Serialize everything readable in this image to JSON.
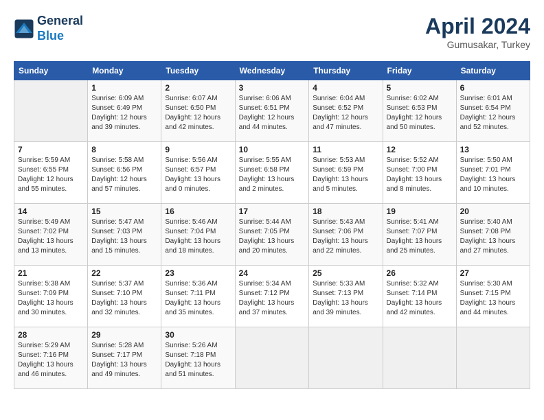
{
  "header": {
    "logo_line1": "General",
    "logo_line2": "Blue",
    "month": "April 2024",
    "location": "Gumusakar, Turkey"
  },
  "columns": [
    "Sunday",
    "Monday",
    "Tuesday",
    "Wednesday",
    "Thursday",
    "Friday",
    "Saturday"
  ],
  "weeks": [
    [
      {
        "day": "",
        "info": ""
      },
      {
        "day": "1",
        "info": "Sunrise: 6:09 AM\nSunset: 6:49 PM\nDaylight: 12 hours\nand 39 minutes."
      },
      {
        "day": "2",
        "info": "Sunrise: 6:07 AM\nSunset: 6:50 PM\nDaylight: 12 hours\nand 42 minutes."
      },
      {
        "day": "3",
        "info": "Sunrise: 6:06 AM\nSunset: 6:51 PM\nDaylight: 12 hours\nand 44 minutes."
      },
      {
        "day": "4",
        "info": "Sunrise: 6:04 AM\nSunset: 6:52 PM\nDaylight: 12 hours\nand 47 minutes."
      },
      {
        "day": "5",
        "info": "Sunrise: 6:02 AM\nSunset: 6:53 PM\nDaylight: 12 hours\nand 50 minutes."
      },
      {
        "day": "6",
        "info": "Sunrise: 6:01 AM\nSunset: 6:54 PM\nDaylight: 12 hours\nand 52 minutes."
      }
    ],
    [
      {
        "day": "7",
        "info": "Sunrise: 5:59 AM\nSunset: 6:55 PM\nDaylight: 12 hours\nand 55 minutes."
      },
      {
        "day": "8",
        "info": "Sunrise: 5:58 AM\nSunset: 6:56 PM\nDaylight: 12 hours\nand 57 minutes."
      },
      {
        "day": "9",
        "info": "Sunrise: 5:56 AM\nSunset: 6:57 PM\nDaylight: 13 hours\nand 0 minutes."
      },
      {
        "day": "10",
        "info": "Sunrise: 5:55 AM\nSunset: 6:58 PM\nDaylight: 13 hours\nand 2 minutes."
      },
      {
        "day": "11",
        "info": "Sunrise: 5:53 AM\nSunset: 6:59 PM\nDaylight: 13 hours\nand 5 minutes."
      },
      {
        "day": "12",
        "info": "Sunrise: 5:52 AM\nSunset: 7:00 PM\nDaylight: 13 hours\nand 8 minutes."
      },
      {
        "day": "13",
        "info": "Sunrise: 5:50 AM\nSunset: 7:01 PM\nDaylight: 13 hours\nand 10 minutes."
      }
    ],
    [
      {
        "day": "14",
        "info": "Sunrise: 5:49 AM\nSunset: 7:02 PM\nDaylight: 13 hours\nand 13 minutes."
      },
      {
        "day": "15",
        "info": "Sunrise: 5:47 AM\nSunset: 7:03 PM\nDaylight: 13 hours\nand 15 minutes."
      },
      {
        "day": "16",
        "info": "Sunrise: 5:46 AM\nSunset: 7:04 PM\nDaylight: 13 hours\nand 18 minutes."
      },
      {
        "day": "17",
        "info": "Sunrise: 5:44 AM\nSunset: 7:05 PM\nDaylight: 13 hours\nand 20 minutes."
      },
      {
        "day": "18",
        "info": "Sunrise: 5:43 AM\nSunset: 7:06 PM\nDaylight: 13 hours\nand 22 minutes."
      },
      {
        "day": "19",
        "info": "Sunrise: 5:41 AM\nSunset: 7:07 PM\nDaylight: 13 hours\nand 25 minutes."
      },
      {
        "day": "20",
        "info": "Sunrise: 5:40 AM\nSunset: 7:08 PM\nDaylight: 13 hours\nand 27 minutes."
      }
    ],
    [
      {
        "day": "21",
        "info": "Sunrise: 5:38 AM\nSunset: 7:09 PM\nDaylight: 13 hours\nand 30 minutes."
      },
      {
        "day": "22",
        "info": "Sunrise: 5:37 AM\nSunset: 7:10 PM\nDaylight: 13 hours\nand 32 minutes."
      },
      {
        "day": "23",
        "info": "Sunrise: 5:36 AM\nSunset: 7:11 PM\nDaylight: 13 hours\nand 35 minutes."
      },
      {
        "day": "24",
        "info": "Sunrise: 5:34 AM\nSunset: 7:12 PM\nDaylight: 13 hours\nand 37 minutes."
      },
      {
        "day": "25",
        "info": "Sunrise: 5:33 AM\nSunset: 7:13 PM\nDaylight: 13 hours\nand 39 minutes."
      },
      {
        "day": "26",
        "info": "Sunrise: 5:32 AM\nSunset: 7:14 PM\nDaylight: 13 hours\nand 42 minutes."
      },
      {
        "day": "27",
        "info": "Sunrise: 5:30 AM\nSunset: 7:15 PM\nDaylight: 13 hours\nand 44 minutes."
      }
    ],
    [
      {
        "day": "28",
        "info": "Sunrise: 5:29 AM\nSunset: 7:16 PM\nDaylight: 13 hours\nand 46 minutes."
      },
      {
        "day": "29",
        "info": "Sunrise: 5:28 AM\nSunset: 7:17 PM\nDaylight: 13 hours\nand 49 minutes."
      },
      {
        "day": "30",
        "info": "Sunrise: 5:26 AM\nSunset: 7:18 PM\nDaylight: 13 hours\nand 51 minutes."
      },
      {
        "day": "",
        "info": ""
      },
      {
        "day": "",
        "info": ""
      },
      {
        "day": "",
        "info": ""
      },
      {
        "day": "",
        "info": ""
      }
    ]
  ]
}
